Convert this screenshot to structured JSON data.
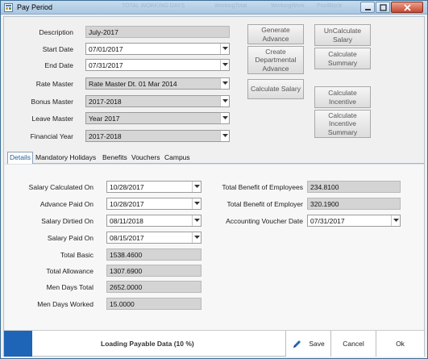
{
  "window": {
    "title": "Pay Period",
    "ghost_titles": [
      "TOTAL WORKING DAYS",
      "WorkingTotal",
      "WorkingWork",
      "PoolBlock"
    ]
  },
  "form": {
    "description": {
      "label": "Description",
      "value": "July-2017"
    },
    "start_date": {
      "label": "Start Date",
      "value": "07/01/2017"
    },
    "end_date": {
      "label": "End Date",
      "value": "07/31/2017"
    },
    "rate_master": {
      "label": "Rate  Master",
      "value": "Rate Master Dt. 01 Mar 2014"
    },
    "bonus_master": {
      "label": "Bonus Master",
      "value": "2017-2018"
    },
    "leave_master": {
      "label": "Leave Master",
      "value": "Year 2017"
    },
    "financial_year": {
      "label": "Financial Year",
      "value": "2017-2018"
    }
  },
  "actions": {
    "generate_advance": "Generate Advance",
    "create_departmental_advance": "Create Departmental Advance",
    "calculate_salary": "Calculate Salary",
    "uncalculate_salary": "UnCalculate Salary",
    "calculate_summary": "Calculate Summary",
    "calculate_incentive": "Calculate Incentive",
    "calculate_incentive_summary": "Calculate Incentive Summary"
  },
  "tabs": [
    {
      "label": "Details",
      "active": true
    },
    {
      "label": "Mandatory Holidays",
      "active": false
    },
    {
      "label": "Benefits",
      "active": false
    },
    {
      "label": "Vouchers",
      "active": false
    },
    {
      "label": "Campus",
      "active": false
    }
  ],
  "details": {
    "salary_calculated_on": {
      "label": "Salary Calculated On",
      "value": "10/28/2017"
    },
    "advance_paid_on": {
      "label": "Advance Paid On",
      "value": "10/28/2017"
    },
    "salary_dirtied_on": {
      "label": "Salary Dirtied On",
      "value": "08/11/2018"
    },
    "salary_paid_on": {
      "label": "Salary Paid On",
      "value": "08/15/2017"
    },
    "total_basic": {
      "label": "Total Basic",
      "value": "1538.4600"
    },
    "total_allowance": {
      "label": "Total  Allowance",
      "value": "1307.6900"
    },
    "men_days_total": {
      "label": "Men Days Total",
      "value": "2652.0000"
    },
    "men_days_worked": {
      "label": "Men Days Worked",
      "value": "15.0000"
    },
    "total_benefit_employees": {
      "label": "Total Benefit of Employees",
      "value": "234.8100"
    },
    "total_benefit_employer": {
      "label": "Total Benefit of Employer",
      "value": "320.1900"
    },
    "accounting_voucher_date": {
      "label": "Accounting Voucher Date",
      "value": "07/31/2017"
    }
  },
  "status": {
    "loading_text": "Loading Payable Data (10 %)"
  },
  "footer": {
    "save": "Save",
    "cancel": "Cancel",
    "ok": "Ok"
  },
  "colors": {
    "accent_blue": "#1e64b7",
    "readonly_bg": "#d4d4d4",
    "close_red": "#c8482f"
  }
}
